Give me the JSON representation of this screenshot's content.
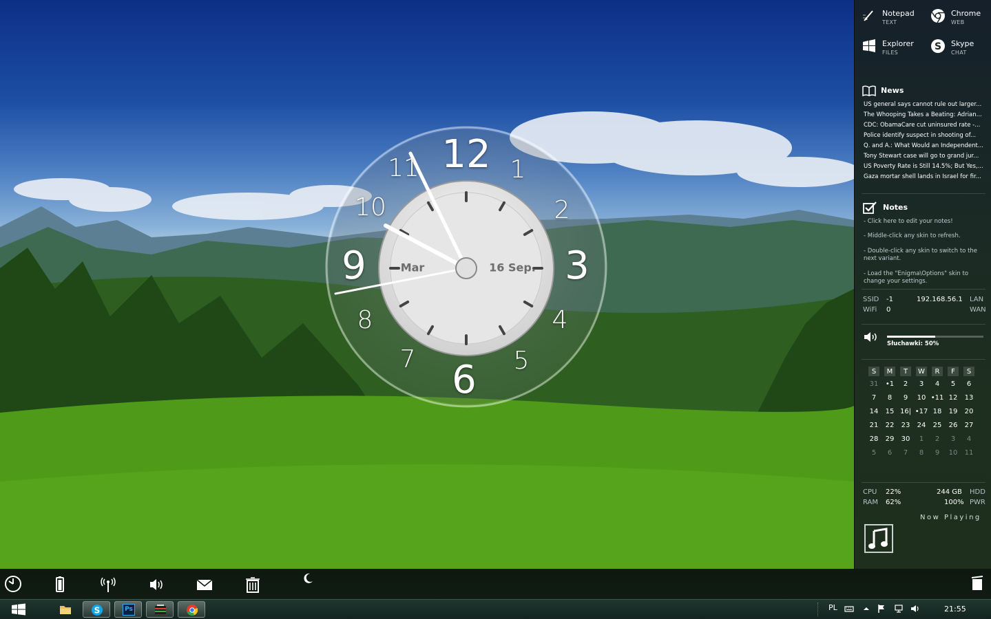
{
  "clock": {
    "numbers": [
      "12",
      "1",
      "2",
      "3",
      "4",
      "5",
      "6",
      "7",
      "8",
      "9",
      "10",
      "11"
    ],
    "left_label": "Mar",
    "right_label": "16 Sep."
  },
  "launchers": [
    {
      "name": "Notepad",
      "sub": "TEXT",
      "icon": "notepad-icon"
    },
    {
      "name": "Chrome",
      "sub": "WEB",
      "icon": "chrome-icon"
    },
    {
      "name": "Explorer",
      "sub": "FILES",
      "icon": "windows-icon"
    },
    {
      "name": "Skype",
      "sub": "CHAT",
      "icon": "skype-icon"
    }
  ],
  "news": {
    "title": "News",
    "items": [
      "US general says cannot rule out larger...",
      "The Whooping Takes a Beating: Adrian...",
      "CDC: ObamaCare cut uninsured rate -...",
      "Police identify suspect in shooting of...",
      "Q. and A.: What Would an Independent...",
      "Tony Stewart case will go to grand jur...",
      "US Poverty Rate is Still 14.5%; But Yes,...",
      "Gaza mortar shell lands in Israel for fir..."
    ]
  },
  "notes": {
    "title": "Notes",
    "items": [
      "- Click here to edit your notes!",
      "- Middle-click any skin to refresh.",
      "- Double-click any skin to switch to the next variant.",
      "- Load the \"Enigma\\Options\" skin to change your settings."
    ]
  },
  "network": {
    "ssid_label": "SSID",
    "ssid_value": "-1",
    "wifi_label": "WiFi",
    "wifi_value": "0",
    "ip": "192.168.56.1",
    "lan_label": "LAN",
    "wan_label": "WAN"
  },
  "volume": {
    "label": "Słuchawki: 50%",
    "level": 0.5
  },
  "calendar": {
    "headers": [
      "S",
      "M",
      "T",
      "W",
      "R",
      "F",
      "S"
    ],
    "weeks": [
      [
        {
          "d": "31",
          "o": true
        },
        {
          "d": "•1"
        },
        {
          "d": "2"
        },
        {
          "d": "3"
        },
        {
          "d": "4"
        },
        {
          "d": "5"
        },
        {
          "d": "6"
        }
      ],
      [
        {
          "d": "7"
        },
        {
          "d": "8"
        },
        {
          "d": "9"
        },
        {
          "d": "10"
        },
        {
          "d": "•11"
        },
        {
          "d": "12"
        },
        {
          "d": "13"
        }
      ],
      [
        {
          "d": "14"
        },
        {
          "d": "15"
        },
        {
          "d": "16|"
        },
        {
          "d": "•17"
        },
        {
          "d": "18"
        },
        {
          "d": "19"
        },
        {
          "d": "20"
        }
      ],
      [
        {
          "d": "21"
        },
        {
          "d": "22"
        },
        {
          "d": "23"
        },
        {
          "d": "24"
        },
        {
          "d": "25"
        },
        {
          "d": "26"
        },
        {
          "d": "27"
        }
      ],
      [
        {
          "d": "28"
        },
        {
          "d": "29"
        },
        {
          "d": "30"
        },
        {
          "d": "1",
          "o": true
        },
        {
          "d": "2",
          "o": true
        },
        {
          "d": "3",
          "o": true
        },
        {
          "d": "4",
          "o": true
        }
      ],
      [
        {
          "d": "5",
          "o": true
        },
        {
          "d": "6",
          "o": true
        },
        {
          "d": "7",
          "o": true
        },
        {
          "d": "8",
          "o": true
        },
        {
          "d": "9",
          "o": true
        },
        {
          "d": "10",
          "o": true
        },
        {
          "d": "11",
          "o": true
        }
      ]
    ]
  },
  "system": {
    "cpu_label": "CPU",
    "cpu_value": "22%",
    "ram_label": "RAM",
    "ram_value": "62%",
    "hdd_value": "244 GB",
    "hdd_label": "HDD",
    "pwr_value": "100%",
    "pwr_label": "PWR"
  },
  "now_playing": {
    "title": "Now Playing"
  },
  "dock_icons": [
    "clock-icon",
    "battery-icon",
    "wireless-icon",
    "volume-icon",
    "mail-icon",
    "trash-icon",
    "moon-icon"
  ],
  "taskbar": {
    "apps": [
      "explorer-icon",
      "skype-icon",
      "photoshop-icon",
      "app-icon",
      "chrome-icon"
    ],
    "photoshop_label": "Ps",
    "lang": "PL",
    "time": "21:55"
  }
}
